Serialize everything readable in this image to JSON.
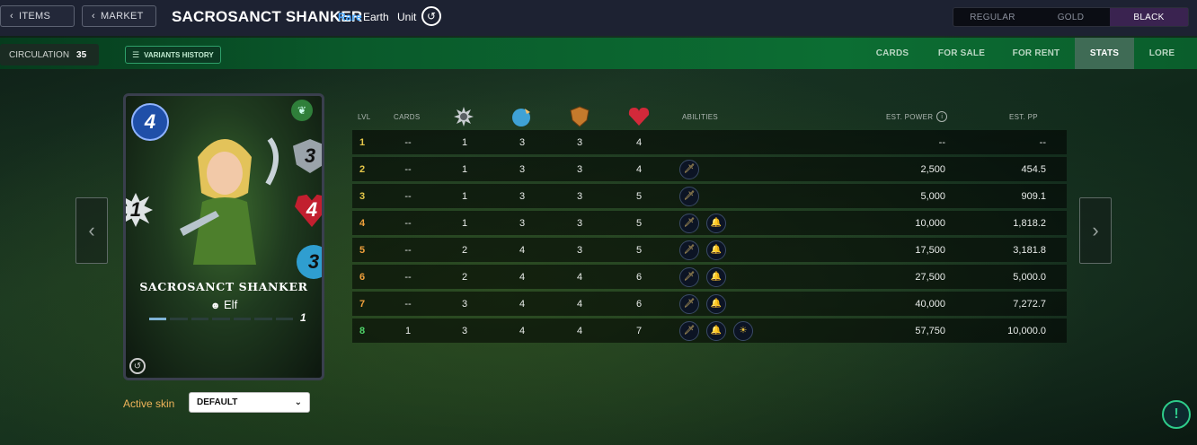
{
  "topbar": {
    "items_label": "ITEMS",
    "market_label": "MARKET",
    "card_title": "SACROSANCT SHANKER",
    "rarity": "Rare",
    "element": "Earth",
    "type": "Unit",
    "foils": [
      "REGULAR",
      "GOLD",
      "BLACK"
    ],
    "active_foil": "BLACK"
  },
  "subbar": {
    "circulation_label": "CIRCULATION",
    "circulation_value": "35",
    "variants_history_label": "VARIANTS HISTORY",
    "tabs": [
      "CARDS",
      "FOR SALE",
      "FOR RENT",
      "STATS",
      "LORE"
    ],
    "active_tab": "STATS"
  },
  "card": {
    "name": "SACROSANCT SHANKER",
    "tribe": "Elf",
    "mana": "4",
    "attack": "1",
    "armor": "3",
    "health": "4",
    "speed": "3",
    "level": "1"
  },
  "skin": {
    "label": "Active skin",
    "value": "DEFAULT"
  },
  "stats_table": {
    "headers": {
      "level": "LVL",
      "cards": "CARDS",
      "abilities": "ABILITIES",
      "est_power": "EST. POWER",
      "est_pp": "EST. PP"
    },
    "stat_icons": [
      "melee-attack-icon",
      "speed-icon",
      "armor-icon",
      "health-icon"
    ],
    "rows": [
      {
        "lvl": "1",
        "cards": "--",
        "atk": "1",
        "spd": "3",
        "arm": "3",
        "hp": "4",
        "abilities": [],
        "power": "--",
        "pp": "--"
      },
      {
        "lvl": "2",
        "cards": "--",
        "atk": "1",
        "spd": "3",
        "arm": "3",
        "hp": "4",
        "abilities": [
          "dagger"
        ],
        "power": "2,500",
        "pp": "454.5"
      },
      {
        "lvl": "3",
        "cards": "--",
        "atk": "1",
        "spd": "3",
        "arm": "3",
        "hp": "5",
        "abilities": [
          "dagger"
        ],
        "power": "5,000",
        "pp": "909.1"
      },
      {
        "lvl": "4",
        "cards": "--",
        "atk": "1",
        "spd": "3",
        "arm": "3",
        "hp": "5",
        "abilities": [
          "dagger",
          "bell"
        ],
        "power": "10,000",
        "pp": "1,818.2"
      },
      {
        "lvl": "5",
        "cards": "--",
        "atk": "2",
        "spd": "4",
        "arm": "3",
        "hp": "5",
        "abilities": [
          "dagger",
          "bell"
        ],
        "power": "17,500",
        "pp": "3,181.8"
      },
      {
        "lvl": "6",
        "cards": "--",
        "atk": "2",
        "spd": "4",
        "arm": "4",
        "hp": "6",
        "abilities": [
          "dagger",
          "bell"
        ],
        "power": "27,500",
        "pp": "5,000.0"
      },
      {
        "lvl": "7",
        "cards": "--",
        "atk": "3",
        "spd": "4",
        "arm": "4",
        "hp": "6",
        "abilities": [
          "dagger",
          "bell"
        ],
        "power": "40,000",
        "pp": "7,272.7"
      },
      {
        "lvl": "8",
        "cards": "1",
        "atk": "3",
        "spd": "4",
        "arm": "4",
        "hp": "7",
        "abilities": [
          "dagger",
          "bell",
          "sun"
        ],
        "power": "57,750",
        "pp": "10,000.0"
      }
    ]
  },
  "colors": {
    "level_low": "#e6c84a",
    "level_mid": "#f0a03c",
    "level_max": "#4fd36a",
    "rarity": "#4aa8ff",
    "skin_label": "#f0b45a"
  }
}
